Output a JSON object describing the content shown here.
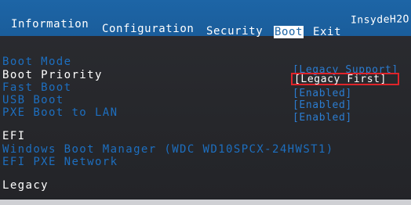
{
  "header": {
    "vendor": "InsydeH2O",
    "tabs": [
      {
        "label": "Information",
        "active": false
      },
      {
        "label": "Configuration",
        "active": false
      },
      {
        "label": "Security",
        "active": false
      },
      {
        "label": "Boot",
        "active": true
      },
      {
        "label": "Exit",
        "active": false
      }
    ]
  },
  "settings": [
    {
      "label": "Boot Mode",
      "value": "[Legacy Support]",
      "highlighted": false
    },
    {
      "label": "Boot Priority",
      "value": "[Legacy First]",
      "highlighted": true
    },
    {
      "label": "Fast Boot",
      "value": "[Enabled]",
      "highlighted": false
    },
    {
      "label": "USB Boot",
      "value": "[Enabled]",
      "highlighted": false
    },
    {
      "label": "PXE Boot to LAN",
      "value": "[Enabled]",
      "highlighted": false
    }
  ],
  "efi": {
    "heading": "EFI",
    "items": [
      "Windows Boot Manager (WDC WD10SPCX-24HWST1)",
      "EFI PXE Network"
    ]
  },
  "legacy": {
    "heading": "Legacy"
  },
  "colors": {
    "header_bg": "#1d65a6",
    "screen_bg": "#2b2c31",
    "label": "#1d6fc0",
    "highlight": "#ffffff",
    "annotation_box": "#e0242a"
  }
}
